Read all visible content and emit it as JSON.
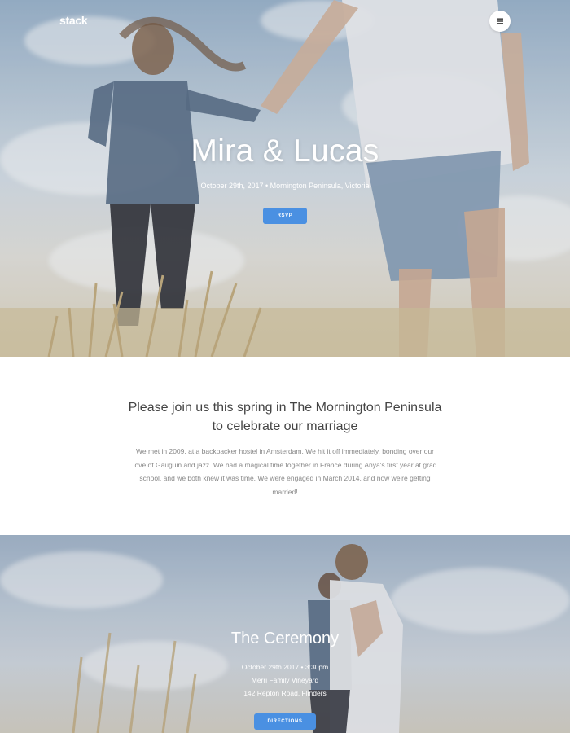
{
  "nav": {
    "logo": "stack",
    "menu_icon": "hamburger-icon"
  },
  "hero": {
    "title": "Mira & Lucas",
    "subtitle": "October 29th, 2017 • Mornington Peninsula, Victoria",
    "rsvp_label": "RSVP"
  },
  "invitation": {
    "heading": "Please join us this spring in The Mornington Peninsula to celebrate our marriage",
    "body": "We met in 2009, at a backpacker hostel in Amsterdam. We hit it off immediately, bonding over our love of Gauguin and jazz. We had a magical time together in France during Anya's first year at grad school, and we both knew it was time. We were engaged in March 2014, and now we're getting married!"
  },
  "ceremony": {
    "title": "The Ceremony",
    "datetime": "October 29th 2017 • 3:30pm",
    "venue": "Merri Family Vineyard",
    "address": "142 Repton Road, Flinders",
    "directions_label": "DIRECTIONS"
  },
  "colors": {
    "accent": "#4a90e2",
    "hero_text": "#ffffff",
    "body_text": "#888888",
    "heading_text": "#444444"
  }
}
